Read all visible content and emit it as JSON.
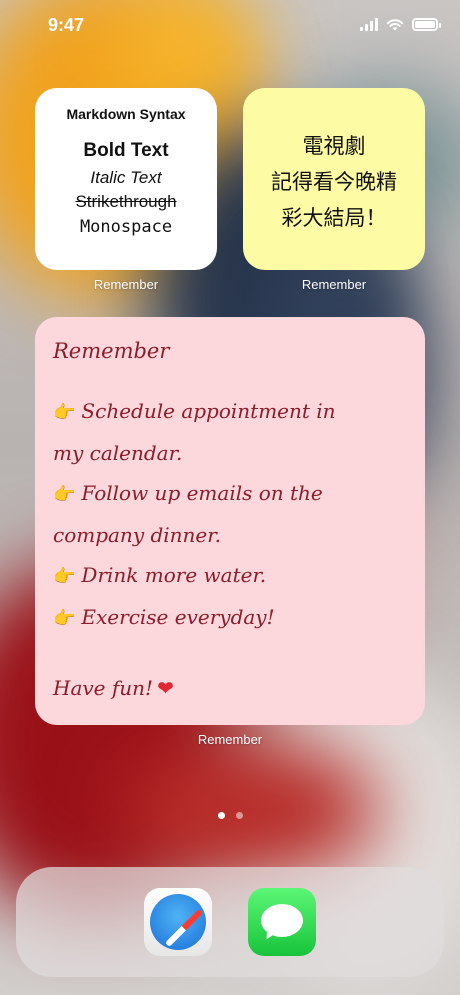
{
  "status_bar": {
    "time": "9:47",
    "icons": [
      "signal-icon",
      "wifi-icon",
      "battery-icon"
    ]
  },
  "widgets": {
    "markdown": {
      "title": "Markdown Syntax",
      "bold": "Bold Text",
      "italic": "Italic Text",
      "strike": "Strikethrough",
      "mono": "Monospace",
      "label": "Remember",
      "bg": "#ffffff"
    },
    "chinese": {
      "lines": [
        "電視劇",
        "記得看今晚精",
        "彩大結局！"
      ],
      "label": "Remember",
      "bg": "#fdfba3"
    },
    "reminder": {
      "title": "Remember",
      "items": [
        "Schedule appointment in",
        "my calendar.",
        "Follow up emails on the",
        "company dinner.",
        "Drink more water.",
        "Exercise everyday!"
      ],
      "footer": "Have fun!",
      "label": "Remember",
      "bg": "#fcd7dc",
      "text_color": "#8c1d2a"
    }
  },
  "page_dots": {
    "count": 2,
    "active": 1
  },
  "dock": {
    "apps": [
      {
        "name": "Safari"
      },
      {
        "name": "Messages"
      }
    ]
  }
}
